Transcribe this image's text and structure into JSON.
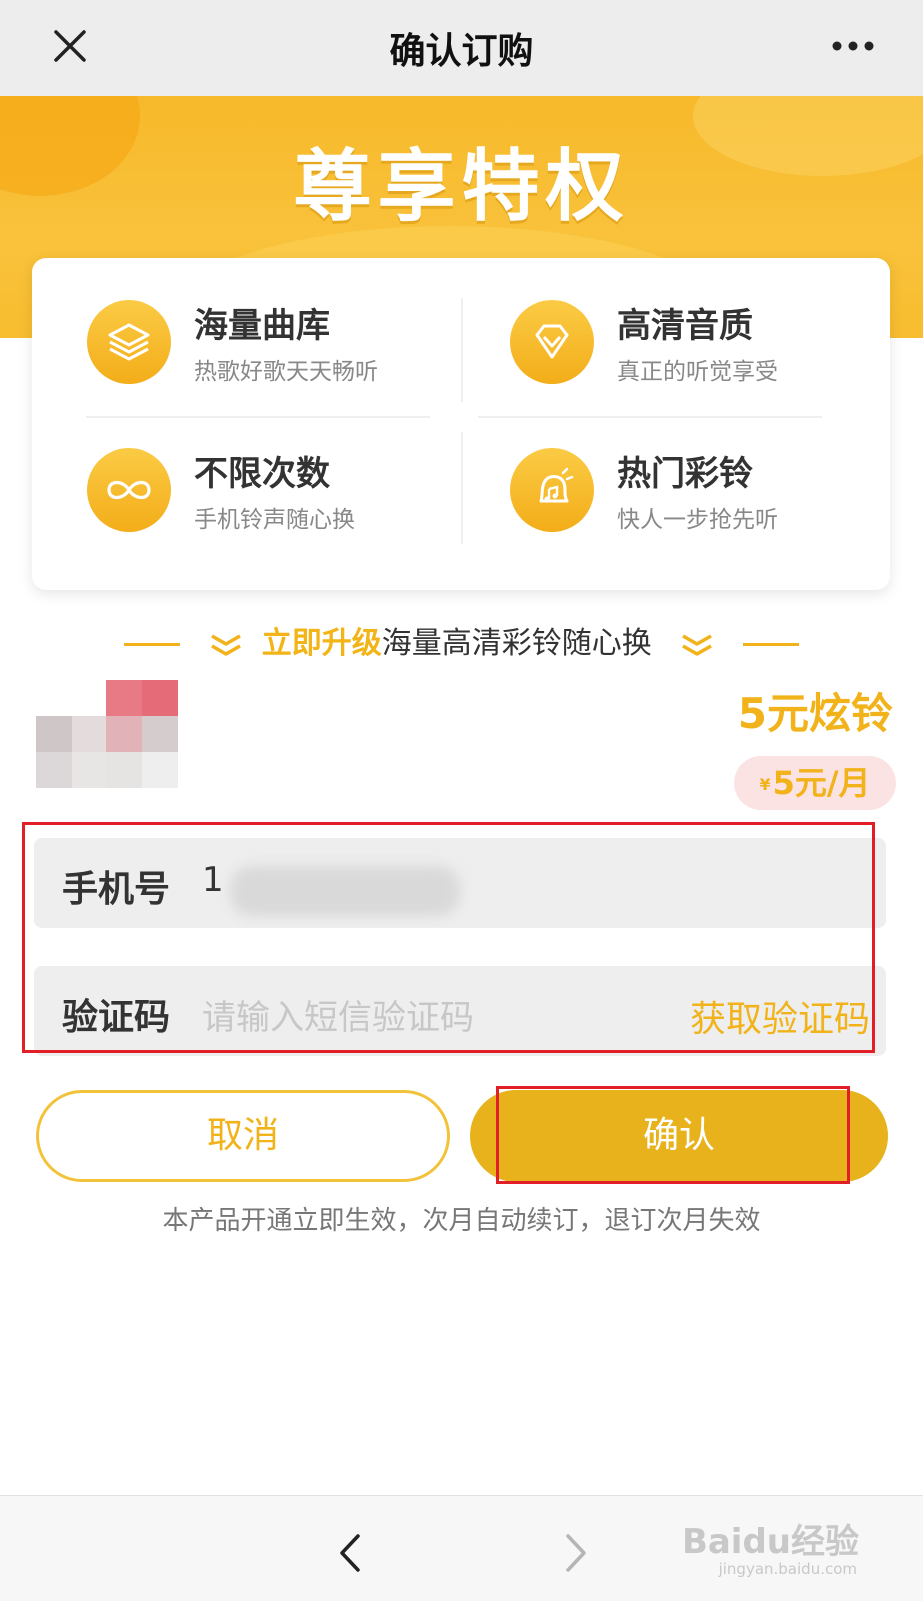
{
  "header": {
    "title": "确认订购",
    "close_icon": "close-icon",
    "more_icon": "more-icon"
  },
  "banner": {
    "headline": "尊享特权"
  },
  "features": [
    {
      "title": "海量曲库",
      "subtitle": "热歌好歌天天畅听",
      "icon": "layers-icon"
    },
    {
      "title": "高清音质",
      "subtitle": "真正的听觉享受",
      "icon": "diamond-icon"
    },
    {
      "title": "不限次数",
      "subtitle": "手机铃声随心换",
      "icon": "infinity-icon"
    },
    {
      "title": "热门彩铃",
      "subtitle": "快人一步抢先听",
      "icon": "bell-icon"
    }
  ],
  "upgrade": {
    "highlight": "立即升级",
    "text": "海量高清彩铃随心换"
  },
  "product": {
    "name": "5元炫铃",
    "price_symbol": "¥",
    "price": "5元/月"
  },
  "form": {
    "phone_label": "手机号",
    "phone_value": "1",
    "code_label": "验证码",
    "code_placeholder": "请输入短信验证码",
    "get_code": "获取验证码"
  },
  "buttons": {
    "cancel": "取消",
    "confirm": "确认"
  },
  "note": "本产品开通立即生效，次月自动续订，退订次月失效",
  "watermark": {
    "brand": "Baidu经验",
    "url": "jingyan.baidu.com"
  },
  "colors": {
    "accent": "#f2b21a",
    "confirm_bg": "#e7b21c",
    "highlight_box": "#e21f26"
  }
}
